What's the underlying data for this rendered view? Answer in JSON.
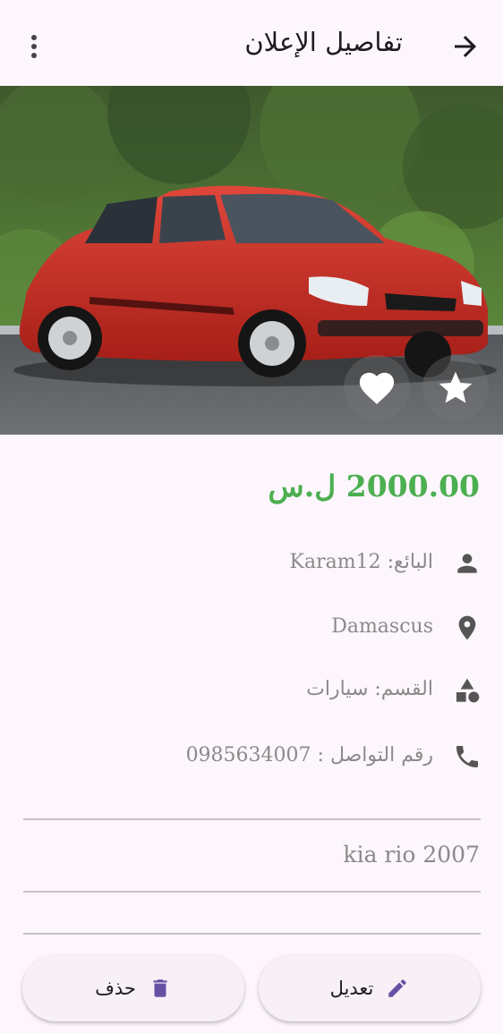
{
  "appbar": {
    "title": "تفاصيل الإعلان",
    "back_icon": "arrow-forward-icon",
    "menu_icon": "more-vert-icon"
  },
  "ad": {
    "image_alt": "red sedan car photo",
    "price": "2000.00 ل.س",
    "seller": "البائع: Karam12",
    "location": "Damascus",
    "category": "القسم: سيارات",
    "contact": "رقم التواصل : 0985634007",
    "description": "kia rio 2007"
  },
  "actions": {
    "edit_label": "تعديل",
    "delete_label": "حذف"
  },
  "colors": {
    "price": "#4caf50",
    "accent": "#6750a4",
    "background": "#fdf6fc"
  }
}
